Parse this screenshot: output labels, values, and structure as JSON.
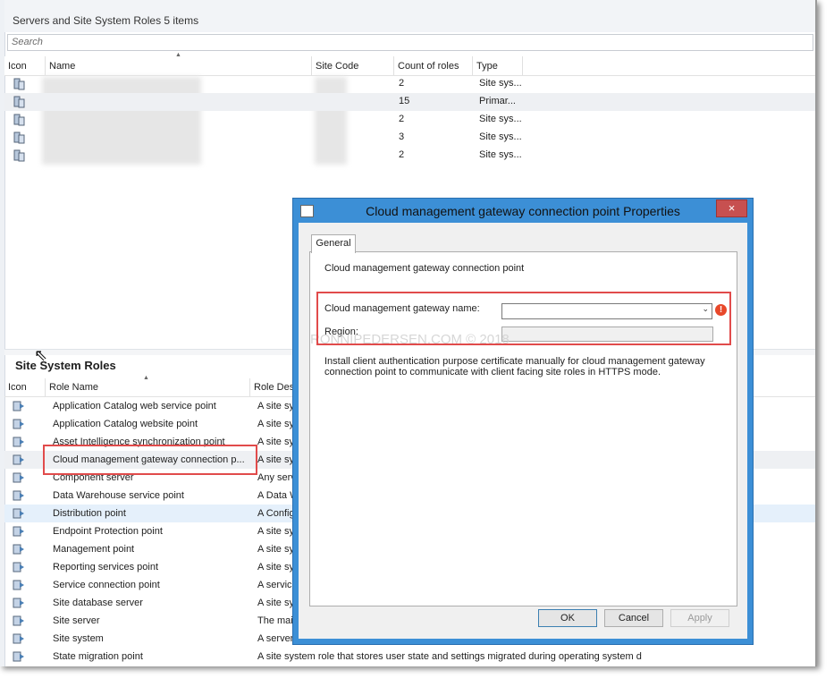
{
  "servers_panel": {
    "title": "Servers and Site System Roles 5 items",
    "search_placeholder": "Search",
    "columns": [
      "Icon",
      "Name",
      "Site Code",
      "Count of roles",
      "Type"
    ],
    "rows": [
      {
        "count": "2",
        "type": "Site sys..."
      },
      {
        "count": "15",
        "type": "Primar..."
      },
      {
        "count": "2",
        "type": "Site sys..."
      },
      {
        "count": "3",
        "type": "Site sys..."
      },
      {
        "count": "2",
        "type": "Site sys..."
      }
    ]
  },
  "roles_panel": {
    "title": "Site System Roles",
    "columns": [
      "Icon",
      "Role Name",
      "Role Des"
    ],
    "rows": [
      {
        "name": "Application Catalog web service point",
        "desc": "A site sy"
      },
      {
        "name": "Application Catalog website point",
        "desc": "A site sy"
      },
      {
        "name": "Asset Intelligence synchronization point",
        "desc": "A site sy"
      },
      {
        "name": "Cloud management gateway connection p...",
        "desc": "A site sy"
      },
      {
        "name": "Component server",
        "desc": "Any serv"
      },
      {
        "name": "Data Warehouse service point",
        "desc": "A Data W"
      },
      {
        "name": "Distribution point",
        "desc": "A Config"
      },
      {
        "name": "Endpoint Protection point",
        "desc": "A site sy"
      },
      {
        "name": "Management point",
        "desc": "A site sy"
      },
      {
        "name": "Reporting services point",
        "desc": "A site sy"
      },
      {
        "name": "Service connection point",
        "desc": "A service"
      },
      {
        "name": "Site database server",
        "desc": "A site sy"
      },
      {
        "name": "Site server",
        "desc": "The mai"
      },
      {
        "name": "Site system",
        "desc": "A server"
      },
      {
        "name": "State migration point",
        "desc": "A site system role that stores user state and settings migrated during operating system d"
      }
    ]
  },
  "dialog": {
    "title": "Cloud management gateway connection point Properties",
    "close": "×",
    "tab": "General",
    "heading": "Cloud management gateway connection point",
    "gateway_label": "Cloud management gateway name:",
    "gateway_value": "",
    "region_label": "Region:",
    "region_value": "",
    "watermark": "RONNIPEDERSEN.COM © 2018",
    "note": "Install client authentication purpose certificate manually for cloud management gateway connection point to communicate with client facing site roles in HTTPS mode.",
    "ok": "OK",
    "cancel": "Cancel",
    "apply": "Apply",
    "error_glyph": "!"
  },
  "colors": {
    "dialog_frame": "#3c8fd6",
    "highlight_box": "#e14b4b",
    "selected_row": "#e5f0fb"
  }
}
